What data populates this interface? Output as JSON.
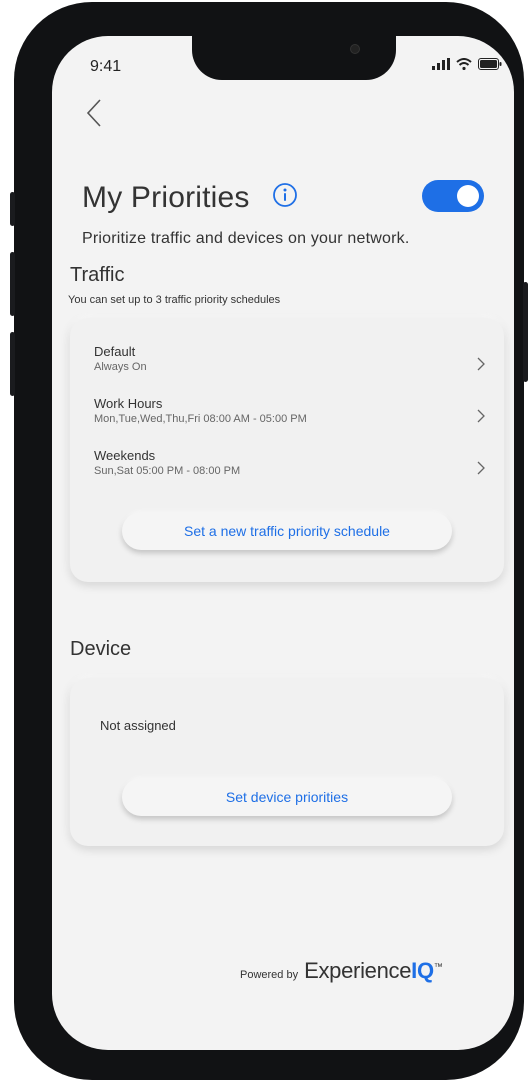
{
  "status_bar": {
    "time": "9:41",
    "icons": [
      "signal-icon",
      "wifi-icon",
      "battery-icon"
    ]
  },
  "header": {
    "back_icon": "chevron-left-icon",
    "title": "My Priorities",
    "info_icon": "info-icon",
    "toggle_on": true,
    "subtitle": "Prioritize traffic and devices on your network."
  },
  "traffic": {
    "title": "Traffic",
    "note": "You can set up to 3 traffic priority schedules",
    "schedules": [
      {
        "name": "Default",
        "detail": "Always On"
      },
      {
        "name": "Work Hours",
        "detail": "Mon,Tue,Wed,Thu,Fri 08:00 AM - 05:00 PM"
      },
      {
        "name": "Weekends",
        "detail": "Sun,Sat 05:00 PM - 08:00 PM"
      }
    ],
    "button_label": "Set a new traffic priority schedule"
  },
  "device": {
    "title": "Device",
    "status": "Not assigned",
    "button_label": "Set device priorities"
  },
  "footer": {
    "powered_by": "Powered by",
    "brand_main": "Experience",
    "brand_accent": "IQ",
    "trademark": "™"
  },
  "colors": {
    "accent": "#1e6fe6",
    "background": "#f3f3f3",
    "text": "#333333"
  }
}
